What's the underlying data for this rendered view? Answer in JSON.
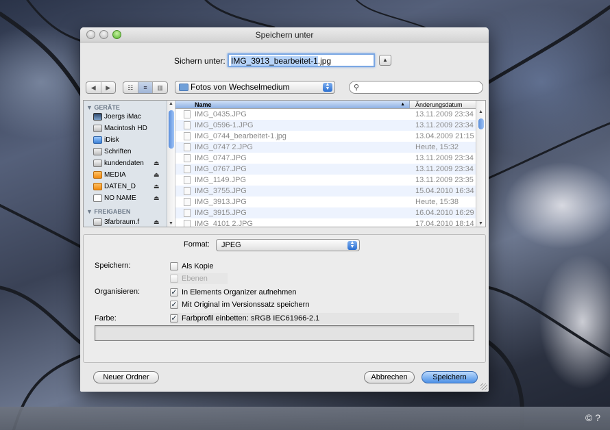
{
  "window": {
    "title": "Speichern unter"
  },
  "save_as": {
    "label": "Sichern unter:",
    "filename_selected": "IMG_3913_bearbeitet-1",
    "filename_ext": ".jpg"
  },
  "toolbar": {
    "back_icon": "◀",
    "forward_icon": "▶",
    "view_icon_grid": "☷",
    "view_icon_list": "≡",
    "view_icon_columns": "▥",
    "location": "Fotos von Wechselmedium",
    "search_placeholder": ""
  },
  "sidebar": {
    "devices_header": "▼ GERÄTE",
    "devices": [
      {
        "label": "Joergs iMac",
        "icon": "imac-icon",
        "eject": false
      },
      {
        "label": "Macintosh HD",
        "icon": "harddisk-icon",
        "eject": false
      },
      {
        "label": "iDisk",
        "icon": "idisk-icon",
        "eject": false
      },
      {
        "label": "Schriften",
        "icon": "drive-icon",
        "eject": false
      },
      {
        "label": "kundendaten",
        "icon": "server-icon",
        "eject": true
      },
      {
        "label": "MEDIA",
        "icon": "external-drive-icon",
        "eject": true
      },
      {
        "label": "DATEN_D",
        "icon": "external-drive-icon",
        "eject": true
      },
      {
        "label": "NO NAME",
        "icon": "removable-disk-icon",
        "eject": true
      }
    ],
    "shares_header": "▼ FREIGABEN",
    "shares": [
      {
        "label": "3farbraum.f",
        "icon": "network-share-icon",
        "eject": true
      }
    ]
  },
  "file_list": {
    "columns": {
      "name": "Name",
      "date": "Änderungsdatum"
    },
    "rows": [
      {
        "name": "IMG_0435.JPG",
        "date": "13.11.2009 23:34"
      },
      {
        "name": "IMG_0596-1.JPG",
        "date": "13.11.2009 23:34"
      },
      {
        "name": "IMG_0744_bearbeitet-1.jpg",
        "date": "13.04.2009 21:15"
      },
      {
        "name": "IMG_0747 2.JPG",
        "date": "Heute, 15:32"
      },
      {
        "name": "IMG_0747.JPG",
        "date": "13.11.2009 23:34"
      },
      {
        "name": "IMG_0767.JPG",
        "date": "13.11.2009 23:34"
      },
      {
        "name": "IMG_1149.JPG",
        "date": "13.11.2009 23:35"
      },
      {
        "name": "IMG_3755.JPG",
        "date": "15.04.2010 16:34"
      },
      {
        "name": "IMG_3913.JPG",
        "date": "Heute, 15:38"
      },
      {
        "name": "IMG_3915.JPG",
        "date": "16.04.2010 16:29"
      },
      {
        "name": "IMG_4101 2.JPG",
        "date": "17.04.2010 18:14"
      }
    ]
  },
  "options": {
    "format_label": "Format:",
    "format_value": "JPEG",
    "save_label": "Speichern:",
    "as_copy": {
      "label": "Als Kopie",
      "checked": false
    },
    "layers": {
      "label": "Ebenen",
      "checked": false,
      "disabled": true
    },
    "organize_label": "Organisieren:",
    "organizer": {
      "label": "In Elements Organizer aufnehmen",
      "checked": true
    },
    "version_set": {
      "label": "Mit Original im Versionssatz speichern",
      "checked": true
    },
    "color_label": "Farbe:",
    "icc_profile": {
      "label": "Farbprofil einbetten: sRGB IEC61966-2.1",
      "checked": true
    }
  },
  "buttons": {
    "new_folder": "Neuer Ordner",
    "cancel": "Abbrechen",
    "save": "Speichern"
  },
  "footer": {
    "copyright": "© ?"
  },
  "colors": {
    "accent": "#4d91e6",
    "selection": "#b6d3f8"
  }
}
